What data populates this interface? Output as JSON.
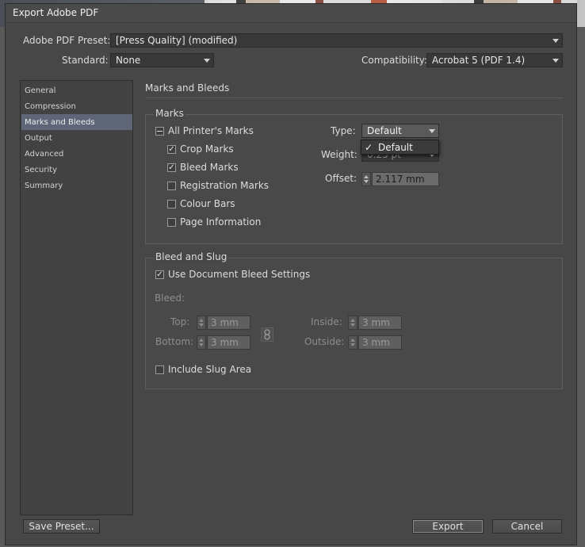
{
  "window": {
    "title": "Export Adobe PDF"
  },
  "preset": {
    "label": "Adobe PDF Preset:",
    "value": "[Press Quality] (modified)"
  },
  "standard": {
    "label": "Standard:",
    "value": "None"
  },
  "compatibility": {
    "label": "Compatibility:",
    "value": "Acrobat 5 (PDF 1.4)"
  },
  "sidebar": {
    "items": [
      {
        "label": "General"
      },
      {
        "label": "Compression"
      },
      {
        "label": "Marks and Bleeds"
      },
      {
        "label": "Output"
      },
      {
        "label": "Advanced"
      },
      {
        "label": "Security"
      },
      {
        "label": "Summary"
      }
    ],
    "active": "Marks and Bleeds"
  },
  "section": {
    "title": "Marks and Bleeds"
  },
  "marks": {
    "title": "Marks",
    "all_printers_marks": {
      "label": "All Printer's Marks",
      "state": "indeterminate"
    },
    "crop_marks": {
      "label": "Crop Marks",
      "checked": true
    },
    "bleed_marks": {
      "label": "Bleed Marks",
      "checked": true
    },
    "registration_marks": {
      "label": "Registration Marks",
      "checked": false
    },
    "colour_bars": {
      "label": "Colour Bars",
      "checked": false
    },
    "page_information": {
      "label": "Page Information",
      "checked": false
    },
    "type": {
      "label": "Type:",
      "value": "Default"
    },
    "type_menu": {
      "option": "Default",
      "checked": true
    },
    "weight": {
      "label": "Weight:",
      "value": "0.25 pt"
    },
    "offset": {
      "label": "Offset:",
      "value": "2.117 mm"
    }
  },
  "bleed_slug": {
    "title": "Bleed and Slug",
    "use_document_bleed": {
      "label": "Use Document Bleed Settings",
      "checked": true
    },
    "bleed_label": "Bleed:",
    "top": {
      "label": "Top:",
      "value": "3 mm"
    },
    "bottom": {
      "label": "Bottom:",
      "value": "3 mm"
    },
    "inside": {
      "label": "Inside:",
      "value": "3 mm"
    },
    "outside": {
      "label": "Outside:",
      "value": "3 mm"
    },
    "include_slug": {
      "label": "Include Slug Area",
      "checked": false
    }
  },
  "buttons": {
    "save_preset": "Save Preset...",
    "export": "Export",
    "cancel": "Cancel"
  },
  "glyphs": {
    "check": "✓",
    "dash": "—"
  }
}
